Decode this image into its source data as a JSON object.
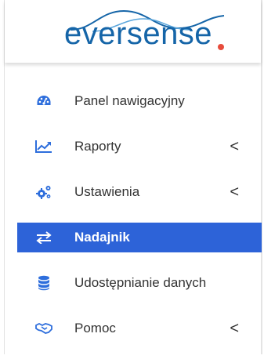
{
  "logo": {
    "text_first": "e",
    "text_rest": "versense",
    "alt": "Eversense"
  },
  "colors": {
    "brand_blue": "#1565a8",
    "accent_red": "#e74c3c",
    "active_bg": "#2d63d8",
    "icon_blue": "#2e6edc"
  },
  "nav": {
    "items": [
      {
        "label": "Panel nawigacyjny",
        "icon": "dashboard-gauge-icon",
        "has_chevron": false,
        "active": false
      },
      {
        "label": "Raporty",
        "icon": "chart-line-icon",
        "has_chevron": true,
        "chevron": "<",
        "active": false
      },
      {
        "label": "Ustawienia",
        "icon": "cogs-icon",
        "has_chevron": true,
        "chevron": "<",
        "active": false
      },
      {
        "label": "Nadajnik",
        "icon": "exchange-arrows-icon",
        "has_chevron": false,
        "active": true
      },
      {
        "label": "Udostępnianie danych",
        "icon": "database-icon",
        "has_chevron": false,
        "active": false
      },
      {
        "label": "Pomoc",
        "icon": "handshake-icon",
        "has_chevron": true,
        "chevron": "<",
        "active": false
      }
    ]
  }
}
